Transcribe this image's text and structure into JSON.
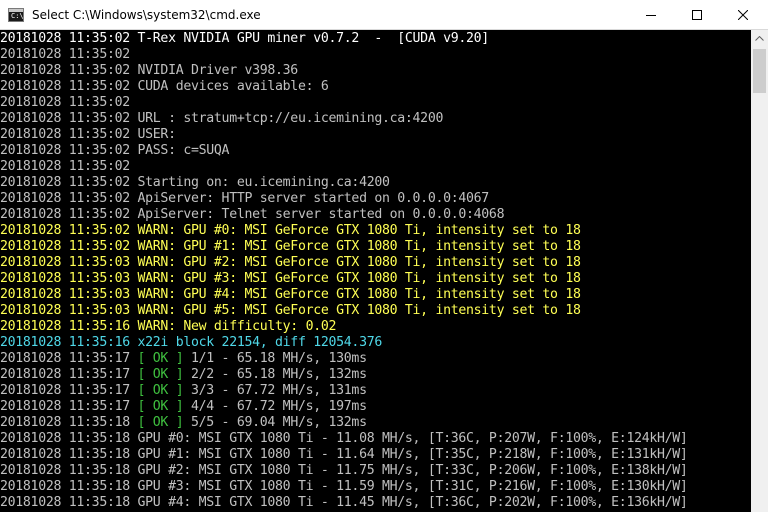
{
  "window": {
    "title": "Select C:\\Windows\\system32\\cmd.exe",
    "icon_glyph": "C:\\"
  },
  "icons": {
    "app": "command-prompt-icon",
    "minimize": "minimize-icon",
    "maximize": "maximize-icon",
    "close": "close-icon",
    "scroll_up": "scroll-up-arrow-icon"
  },
  "colors": {
    "console_background": "#000000",
    "default_text": "#c0c0c0",
    "warning_text": "#ffff54",
    "block_text": "#4fd8e8",
    "ok_text": "#3fc03f"
  },
  "console": {
    "lines": [
      {
        "ts": "20181028 11:35:02",
        "msg": "T-Rex NVIDIA GPU miner v0.7.2  -  [CUDA v9.20]"
      },
      {
        "ts": "20181028 11:35:02",
        "msg": ""
      },
      {
        "ts": "20181028 11:35:02",
        "msg": "NVIDIA Driver v398.36"
      },
      {
        "ts": "20181028 11:35:02",
        "msg": "CUDA devices available: 6"
      },
      {
        "ts": "20181028 11:35:02",
        "msg": ""
      },
      {
        "ts": "20181028 11:35:02",
        "msg": "URL : stratum+tcp://eu.icemining.ca:4200"
      },
      {
        "ts": "20181028 11:35:02",
        "msg": "USER:"
      },
      {
        "ts": "20181028 11:35:02",
        "msg": "PASS: c=SUQA"
      },
      {
        "ts": "20181028 11:35:02",
        "msg": ""
      },
      {
        "ts": "20181028 11:35:02",
        "msg": "Starting on: eu.icemining.ca:4200"
      },
      {
        "ts": "20181028 11:35:02",
        "msg": "ApiServer: HTTP server started on 0.0.0.0:4067"
      },
      {
        "ts": "20181028 11:35:02",
        "msg": "ApiServer: Telnet server started on 0.0.0.0:4068"
      },
      {
        "ts": "20181028 11:35:02",
        "msg": "WARN: GPU #0: MSI GeForce GTX 1080 Ti, intensity set to 18"
      },
      {
        "ts": "20181028 11:35:02",
        "msg": "WARN: GPU #1: MSI GeForce GTX 1080 Ti, intensity set to 18"
      },
      {
        "ts": "20181028 11:35:03",
        "msg": "WARN: GPU #2: MSI GeForce GTX 1080 Ti, intensity set to 18"
      },
      {
        "ts": "20181028 11:35:03",
        "msg": "WARN: GPU #3: MSI GeForce GTX 1080 Ti, intensity set to 18"
      },
      {
        "ts": "20181028 11:35:03",
        "msg": "WARN: GPU #4: MSI GeForce GTX 1080 Ti, intensity set to 18"
      },
      {
        "ts": "20181028 11:35:03",
        "msg": "WARN: GPU #5: MSI GeForce GTX 1080 Ti, intensity set to 18"
      },
      {
        "ts": "20181028 11:35:16",
        "msg": "WARN: New difficulty: 0.02"
      },
      {
        "ts": "20181028 11:35:16",
        "msg": "x22i block 22154, diff 12054.376"
      },
      {
        "ts": "20181028 11:35:17",
        "ok_open": "[",
        "ok": " OK ",
        "ok_close": "]",
        "msg": " 1/1 - 65.18 MH/s, 130ms"
      },
      {
        "ts": "20181028 11:35:17",
        "ok_open": "[",
        "ok": " OK ",
        "ok_close": "]",
        "msg": " 2/2 - 65.18 MH/s, 132ms"
      },
      {
        "ts": "20181028 11:35:17",
        "ok_open": "[",
        "ok": " OK ",
        "ok_close": "]",
        "msg": " 3/3 - 67.72 MH/s, 131ms"
      },
      {
        "ts": "20181028 11:35:17",
        "ok_open": "[",
        "ok": " OK ",
        "ok_close": "]",
        "msg": " 4/4 - 67.72 MH/s, 197ms"
      },
      {
        "ts": "20181028 11:35:18",
        "ok_open": "[",
        "ok": " OK ",
        "ok_close": "]",
        "msg": " 5/5 - 69.04 MH/s, 132ms"
      },
      {
        "ts": "20181028 11:35:18",
        "msg": "GPU #0: MSI GTX 1080 Ti - 11.08 MH/s, [T:36C, P:207W, F:100%, E:124kH/W]"
      },
      {
        "ts": "20181028 11:35:18",
        "msg": "GPU #1: MSI GTX 1080 Ti - 11.64 MH/s, [T:35C, P:218W, F:100%, E:131kH/W]"
      },
      {
        "ts": "20181028 11:35:18",
        "msg": "GPU #2: MSI GTX 1080 Ti - 11.75 MH/s, [T:33C, P:206W, F:100%, E:138kH/W]"
      },
      {
        "ts": "20181028 11:35:18",
        "msg": "GPU #3: MSI GTX 1080 Ti - 11.59 MH/s, [T:31C, P:216W, F:100%, E:130kH/W]"
      },
      {
        "ts": "20181028 11:35:18",
        "msg": "GPU #4: MSI GTX 1080 Ti - 11.45 MH/s, [T:36C, P:202W, F:100%, E:136kH/W]"
      }
    ]
  }
}
